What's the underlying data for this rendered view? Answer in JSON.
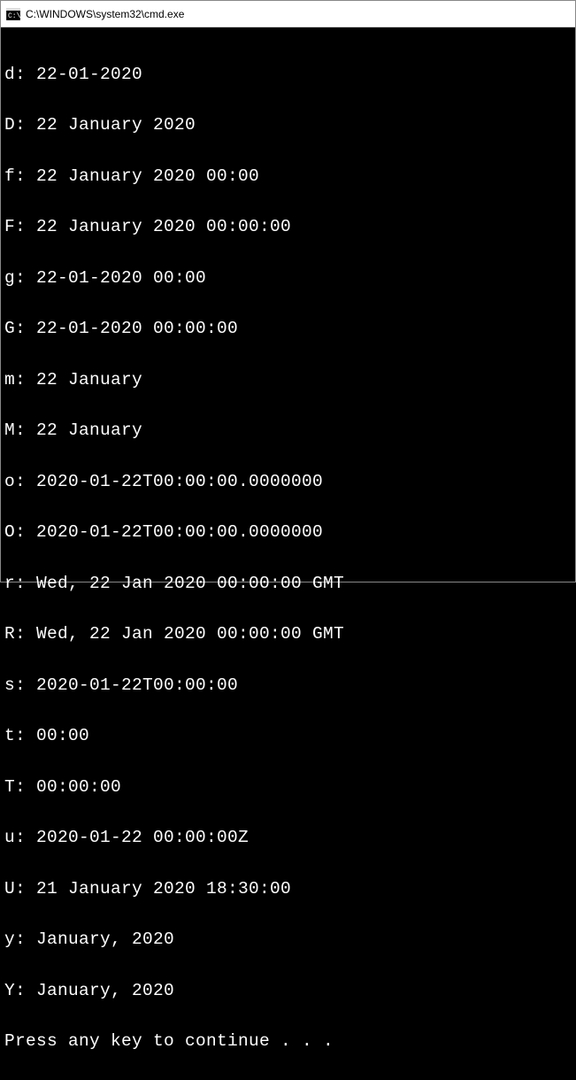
{
  "window": {
    "title": "C:\\WINDOWS\\system32\\cmd.exe"
  },
  "lines": [
    "d: 22-01-2020",
    "D: 22 January 2020",
    "f: 22 January 2020 00:00",
    "F: 22 January 2020 00:00:00",
    "g: 22-01-2020 00:00",
    "G: 22-01-2020 00:00:00",
    "m: 22 January",
    "M: 22 January",
    "o: 2020-01-22T00:00:00.0000000",
    "O: 2020-01-22T00:00:00.0000000",
    "r: Wed, 22 Jan 2020 00:00:00 GMT",
    "R: Wed, 22 Jan 2020 00:00:00 GMT",
    "s: 2020-01-22T00:00:00",
    "t: 00:00",
    "T: 00:00:00",
    "u: 2020-01-22 00:00:00Z",
    "U: 21 January 2020 18:30:00",
    "y: January, 2020",
    "Y: January, 2020",
    "Press any key to continue . . ."
  ]
}
